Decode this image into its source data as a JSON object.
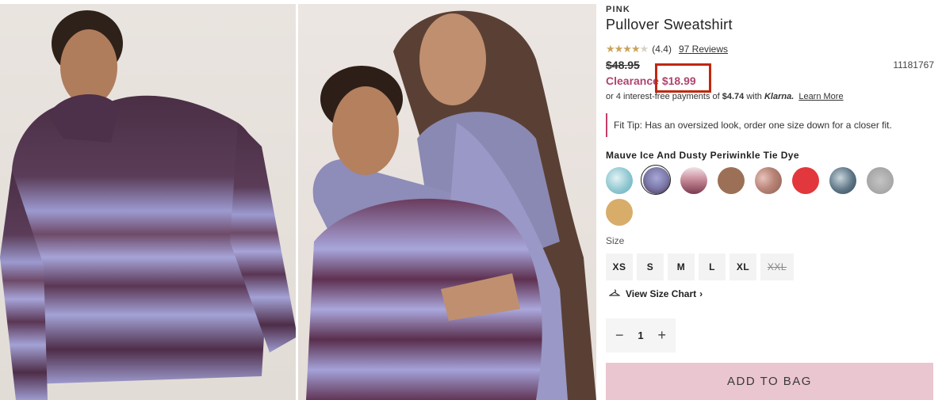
{
  "product": {
    "brand": "PINK",
    "title": "Pullover Sweatshirt",
    "rating_value": 4.4,
    "rating_text": "(4.4)",
    "reviews_label": "97 Reviews",
    "old_price": "$48.95",
    "sale_label": "Clearance",
    "sale_price": "$18.99",
    "sku": "11181767"
  },
  "klarna": {
    "prefix": "or 4 interest-free payments of",
    "amount": "$4.74",
    "with": "with",
    "brand": "Klarna.",
    "link": "Learn More"
  },
  "fit_tip": "Fit Tip: Has an oversized look, order one size down for a closer fit.",
  "color": {
    "selected_name": "Mauve Ice And Dusty Periwinkle Tie Dye",
    "swatches": [
      {
        "name": "aqua-tie-dye",
        "color": "#8fc7d0"
      },
      {
        "name": "mauve-periwinkle-tie-dye",
        "color": "#7c7aaa",
        "selected": true
      },
      {
        "name": "pink-burgundy-tie-dye",
        "color": "#c98d9b"
      },
      {
        "name": "brown",
        "color": "#9c7057"
      },
      {
        "name": "pink-brown-camo",
        "color": "#b98579"
      },
      {
        "name": "red",
        "color": "#e2373c"
      },
      {
        "name": "navy-tie-dye",
        "color": "#5d7585"
      },
      {
        "name": "heather-grey",
        "color": "#a6a6a6"
      },
      {
        "name": "mustard",
        "color": "#d8ad6a"
      }
    ]
  },
  "size": {
    "label": "Size",
    "options": [
      {
        "label": "XS",
        "available": true
      },
      {
        "label": "S",
        "available": true
      },
      {
        "label": "M",
        "available": true
      },
      {
        "label": "L",
        "available": true
      },
      {
        "label": "XL",
        "available": true
      },
      {
        "label": "XXL",
        "available": false
      }
    ],
    "chart_link": "View Size Chart"
  },
  "quantity": {
    "minus": "−",
    "value": "1",
    "plus": "+"
  },
  "add_to_bag": "ADD TO BAG",
  "icons": [
    "hanger-icon",
    "chevron-right-icon",
    "star-icon"
  ],
  "colors": {
    "accent": "#b0456f",
    "button": "#eac6d1",
    "highlight": "#c0280f"
  }
}
